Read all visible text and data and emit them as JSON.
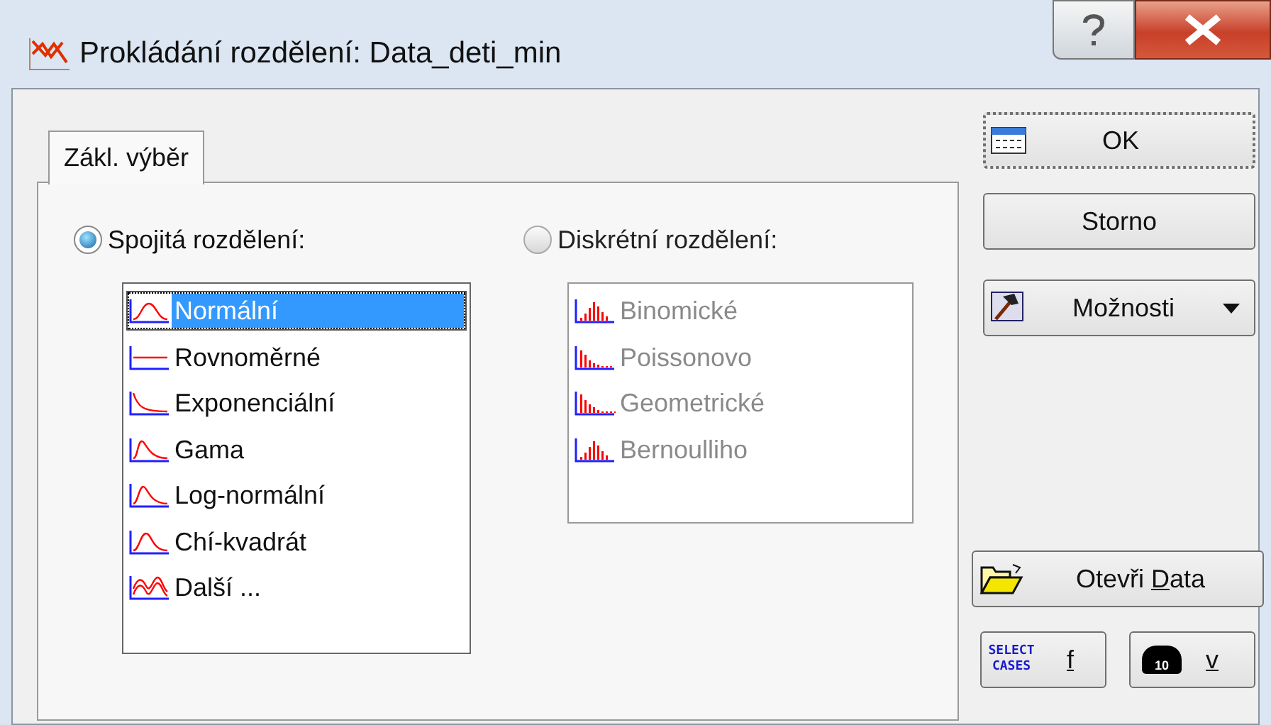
{
  "window": {
    "title": "Prokládání rozdělení: Data_deti_min"
  },
  "tabs": [
    {
      "label": "Zákl. výběr",
      "selected": true
    }
  ],
  "groups": [
    {
      "label": "Spojitá rozdělení:",
      "selected": true,
      "disabled": false,
      "items": [
        {
          "label": "Normální",
          "kind": "normal",
          "selected": true
        },
        {
          "label": "Rovnoměrné",
          "kind": "uniform",
          "selected": false
        },
        {
          "label": "Exponenciální",
          "kind": "exponential",
          "selected": false
        },
        {
          "label": "Gama",
          "kind": "gamma",
          "selected": false
        },
        {
          "label": "Log-normální",
          "kind": "lognormal",
          "selected": false
        },
        {
          "label": "Chí-kvadrát",
          "kind": "chi",
          "selected": false
        },
        {
          "label": "Další ...",
          "kind": "more",
          "selected": false
        }
      ]
    },
    {
      "label": "Diskrétní rozdělení:",
      "selected": false,
      "disabled": true,
      "items": [
        {
          "label": "Binomické",
          "kind": "binomial",
          "selected": false
        },
        {
          "label": "Poissonovo",
          "kind": "poisson",
          "selected": false
        },
        {
          "label": "Geometrické",
          "kind": "geometric",
          "selected": false
        },
        {
          "label": "Bernoulliho",
          "kind": "bernoulli",
          "selected": false
        }
      ]
    }
  ],
  "buttons": {
    "ok": "OK",
    "cancel": "Storno",
    "options": "Možnosti",
    "open_data": {
      "before": "Otevři ",
      "accelerator": "D",
      "after": "ata"
    },
    "select_cases": {
      "icon_text": "SELECT CASES",
      "label": "f"
    },
    "weight": {
      "icon_text": "10",
      "label": "v"
    }
  }
}
